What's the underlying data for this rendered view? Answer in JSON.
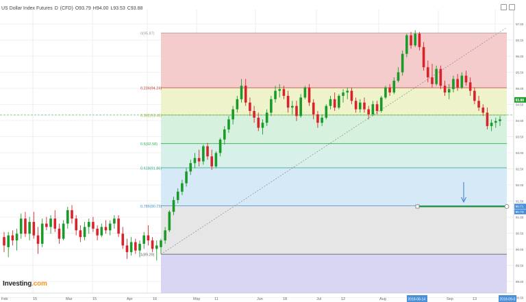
{
  "header": {
    "symbol": "US Dollar Index Futures",
    "interval": "D",
    "source": "(CFD)",
    "open": "O93.79",
    "high": "H94.00",
    "low": "L93.53",
    "close": "C93.88"
  },
  "logo": {
    "brand": "Investing",
    "suffix": ".com"
  },
  "colors": {
    "up": "#1a9a29",
    "down": "#d8232a",
    "accent": "#1f8e2c",
    "marker": "#3b79c9",
    "axis_tag": "#4a90d9"
  },
  "chart_data": {
    "type": "candlestick",
    "title": "US Dollar Index Futures, D, (CFD)",
    "xlabel": "",
    "ylabel": "",
    "ylim": [
      88.2,
      97.3
    ],
    "x_ticks": [
      "Feb",
      "15",
      "Mar",
      "15",
      "Apr",
      "16",
      "May",
      "11",
      "Jun",
      "18",
      "Jul",
      "12",
      "Aug",
      "13",
      "Sep",
      "13"
    ],
    "y_ticks": [
      "97.00",
      "96.50",
      "96.00",
      "95.50",
      "95.00",
      "94.50",
      "94.00",
      "93.50",
      "93.00",
      "92.50",
      "92.00",
      "91.50",
      "91.00",
      "90.50",
      "90.00",
      "89.50",
      "89.00",
      "88.50"
    ],
    "current_price": "93.88",
    "date_tags": [
      "2018-08-14",
      "2018-09-0"
    ],
    "fibonacci": {
      "from": 89.29,
      "to": 95.87,
      "levels": [
        {
          "ratio": 0,
          "label": "0(95.87)",
          "price": 95.87
        },
        {
          "ratio": 0.236,
          "label": "0.236(94.24)",
          "price": 94.24
        },
        {
          "ratio": 0.382,
          "label": "0.382(93.43)",
          "price": 93.43
        },
        {
          "ratio": 0.5,
          "label": "0.5(92.58)",
          "price": 92.58
        },
        {
          "ratio": 0.618,
          "label": "0.618(91.86)",
          "price": 91.86
        },
        {
          "ratio": 0.786,
          "label": "0.786(90.73)",
          "price": 90.73
        },
        {
          "ratio": 1,
          "label": "1(89.29)",
          "price": 89.29
        }
      ],
      "zone_colors": [
        "#f4cccc",
        "#eef3cc",
        "#d6f1dd",
        "#d7f1ea",
        "#d6e9f6",
        "#e6e6e6",
        "#d9d6f4"
      ]
    },
    "price_line": {
      "price": 90.71,
      "tags": [
        "90.71",
        "90.73"
      ]
    },
    "candles": [
      {
        "o": 89.8,
        "h": 89.95,
        "l": 89.35,
        "c": 89.55
      },
      {
        "o": 89.5,
        "h": 89.95,
        "l": 89.2,
        "c": 89.85
      },
      {
        "o": 89.85,
        "h": 90.0,
        "l": 89.55,
        "c": 89.7
      },
      {
        "o": 89.7,
        "h": 90.05,
        "l": 89.4,
        "c": 89.9
      },
      {
        "o": 89.9,
        "h": 90.5,
        "l": 89.75,
        "c": 90.35
      },
      {
        "o": 90.35,
        "h": 90.55,
        "l": 89.8,
        "c": 89.9
      },
      {
        "o": 89.9,
        "h": 90.4,
        "l": 89.7,
        "c": 90.25
      },
      {
        "o": 90.25,
        "h": 90.55,
        "l": 89.75,
        "c": 89.85
      },
      {
        "o": 89.85,
        "h": 90.1,
        "l": 89.3,
        "c": 89.6
      },
      {
        "o": 89.6,
        "h": 90.35,
        "l": 89.5,
        "c": 90.2
      },
      {
        "o": 90.2,
        "h": 90.4,
        "l": 90.0,
        "c": 90.1
      },
      {
        "o": 90.1,
        "h": 90.45,
        "l": 89.9,
        "c": 90.35
      },
      {
        "o": 90.35,
        "h": 90.6,
        "l": 89.95,
        "c": 90.05
      },
      {
        "o": 90.05,
        "h": 90.2,
        "l": 89.6,
        "c": 89.75
      },
      {
        "o": 89.75,
        "h": 90.3,
        "l": 89.7,
        "c": 90.2
      },
      {
        "o": 90.2,
        "h": 90.7,
        "l": 90.05,
        "c": 90.6
      },
      {
        "o": 90.6,
        "h": 90.75,
        "l": 90.2,
        "c": 90.35
      },
      {
        "o": 90.35,
        "h": 90.45,
        "l": 89.85,
        "c": 90.0
      },
      {
        "o": 90.0,
        "h": 90.15,
        "l": 89.65,
        "c": 89.8
      },
      {
        "o": 89.8,
        "h": 90.25,
        "l": 89.7,
        "c": 90.1
      },
      {
        "o": 90.1,
        "h": 90.35,
        "l": 89.9,
        "c": 90.25
      },
      {
        "o": 90.25,
        "h": 90.4,
        "l": 89.95,
        "c": 90.05
      },
      {
        "o": 90.05,
        "h": 90.15,
        "l": 89.7,
        "c": 89.85
      },
      {
        "o": 89.85,
        "h": 90.2,
        "l": 89.8,
        "c": 90.1
      },
      {
        "o": 90.1,
        "h": 90.3,
        "l": 89.9,
        "c": 90.0
      },
      {
        "o": 90.0,
        "h": 90.3,
        "l": 89.85,
        "c": 90.2
      },
      {
        "o": 90.2,
        "h": 90.45,
        "l": 90.05,
        "c": 90.35
      },
      {
        "o": 90.35,
        "h": 90.45,
        "l": 89.8,
        "c": 89.9
      },
      {
        "o": 89.9,
        "h": 90.1,
        "l": 89.45,
        "c": 89.55
      },
      {
        "o": 89.55,
        "h": 89.75,
        "l": 89.15,
        "c": 89.35
      },
      {
        "o": 89.35,
        "h": 89.8,
        "l": 89.25,
        "c": 89.65
      },
      {
        "o": 89.65,
        "h": 89.75,
        "l": 89.3,
        "c": 89.4
      },
      {
        "o": 89.4,
        "h": 89.7,
        "l": 89.2,
        "c": 89.6
      },
      {
        "o": 89.6,
        "h": 89.95,
        "l": 89.45,
        "c": 89.85
      },
      {
        "o": 89.85,
        "h": 90.15,
        "l": 89.55,
        "c": 89.7
      },
      {
        "o": 89.7,
        "h": 89.8,
        "l": 89.35,
        "c": 89.45
      },
      {
        "o": 89.45,
        "h": 89.7,
        "l": 89.1,
        "c": 89.55
      },
      {
        "o": 89.5,
        "h": 89.75,
        "l": 89.3,
        "c": 89.7
      },
      {
        "o": 89.7,
        "h": 90.1,
        "l": 89.6,
        "c": 90.0
      },
      {
        "o": 90.0,
        "h": 90.6,
        "l": 89.95,
        "c": 90.55
      },
      {
        "o": 90.55,
        "h": 91.0,
        "l": 90.45,
        "c": 90.9
      },
      {
        "o": 90.9,
        "h": 91.25,
        "l": 90.8,
        "c": 91.15
      },
      {
        "o": 91.15,
        "h": 91.5,
        "l": 91.05,
        "c": 91.4
      },
      {
        "o": 91.4,
        "h": 91.85,
        "l": 91.3,
        "c": 91.75
      },
      {
        "o": 91.75,
        "h": 92.1,
        "l": 91.65,
        "c": 92.0
      },
      {
        "o": 92.0,
        "h": 92.3,
        "l": 91.85,
        "c": 92.15
      },
      {
        "o": 92.15,
        "h": 92.4,
        "l": 91.9,
        "c": 92.05
      },
      {
        "o": 92.05,
        "h": 92.55,
        "l": 91.95,
        "c": 92.5
      },
      {
        "o": 92.5,
        "h": 92.6,
        "l": 92.1,
        "c": 92.2
      },
      {
        "o": 92.2,
        "h": 92.4,
        "l": 91.8,
        "c": 91.9
      },
      {
        "o": 91.9,
        "h": 92.35,
        "l": 91.85,
        "c": 92.3
      },
      {
        "o": 92.3,
        "h": 92.75,
        "l": 92.2,
        "c": 92.7
      },
      {
        "o": 92.7,
        "h": 93.1,
        "l": 92.55,
        "c": 93.0
      },
      {
        "o": 93.0,
        "h": 93.4,
        "l": 92.9,
        "c": 93.3
      },
      {
        "o": 93.3,
        "h": 93.7,
        "l": 93.15,
        "c": 93.6
      },
      {
        "o": 93.6,
        "h": 94.0,
        "l": 93.5,
        "c": 93.9
      },
      {
        "o": 93.9,
        "h": 94.5,
        "l": 93.8,
        "c": 94.3
      },
      {
        "o": 94.3,
        "h": 94.5,
        "l": 93.7,
        "c": 93.8
      },
      {
        "o": 93.8,
        "h": 93.95,
        "l": 93.4,
        "c": 93.55
      },
      {
        "o": 93.55,
        "h": 93.7,
        "l": 93.2,
        "c": 93.35
      },
      {
        "o": 93.35,
        "h": 93.5,
        "l": 92.95,
        "c": 93.05
      },
      {
        "o": 93.05,
        "h": 93.3,
        "l": 92.85,
        "c": 93.2
      },
      {
        "o": 93.2,
        "h": 93.6,
        "l": 93.1,
        "c": 93.5
      },
      {
        "o": 93.5,
        "h": 94.0,
        "l": 93.4,
        "c": 93.9
      },
      {
        "o": 93.9,
        "h": 94.3,
        "l": 93.8,
        "c": 94.15
      },
      {
        "o": 94.15,
        "h": 94.35,
        "l": 93.95,
        "c": 94.2
      },
      {
        "o": 94.2,
        "h": 94.3,
        "l": 93.9,
        "c": 94.0
      },
      {
        "o": 94.0,
        "h": 94.15,
        "l": 93.5,
        "c": 93.65
      },
      {
        "o": 93.65,
        "h": 93.85,
        "l": 93.45,
        "c": 93.7
      },
      {
        "o": 93.7,
        "h": 93.85,
        "l": 93.25,
        "c": 93.4
      },
      {
        "o": 93.4,
        "h": 94.05,
        "l": 93.35,
        "c": 93.95
      },
      {
        "o": 93.95,
        "h": 94.3,
        "l": 93.9,
        "c": 94.25
      },
      {
        "o": 94.25,
        "h": 94.35,
        "l": 93.7,
        "c": 93.8
      },
      {
        "o": 93.8,
        "h": 93.9,
        "l": 93.3,
        "c": 93.45
      },
      {
        "o": 93.45,
        "h": 93.55,
        "l": 93.05,
        "c": 93.2
      },
      {
        "o": 93.2,
        "h": 93.45,
        "l": 93.1,
        "c": 93.35
      },
      {
        "o": 93.35,
        "h": 93.75,
        "l": 93.3,
        "c": 93.7
      },
      {
        "o": 93.7,
        "h": 94.0,
        "l": 93.6,
        "c": 93.9
      },
      {
        "o": 93.9,
        "h": 94.1,
        "l": 93.55,
        "c": 93.65
      },
      {
        "o": 93.65,
        "h": 94.05,
        "l": 93.6,
        "c": 94.0
      },
      {
        "o": 94.0,
        "h": 94.2,
        "l": 93.8,
        "c": 94.1
      },
      {
        "o": 94.1,
        "h": 94.25,
        "l": 93.9,
        "c": 94.15
      },
      {
        "o": 94.15,
        "h": 94.25,
        "l": 93.75,
        "c": 93.85
      },
      {
        "o": 93.85,
        "h": 93.95,
        "l": 93.5,
        "c": 93.6
      },
      {
        "o": 93.6,
        "h": 93.9,
        "l": 93.5,
        "c": 93.8
      },
      {
        "o": 93.8,
        "h": 93.95,
        "l": 93.5,
        "c": 93.6
      },
      {
        "o": 93.6,
        "h": 93.7,
        "l": 93.3,
        "c": 93.45
      },
      {
        "o": 93.45,
        "h": 93.85,
        "l": 93.4,
        "c": 93.75
      },
      {
        "o": 93.75,
        "h": 93.85,
        "l": 93.45,
        "c": 93.55
      },
      {
        "o": 93.55,
        "h": 94.0,
        "l": 93.5,
        "c": 93.95
      },
      {
        "o": 93.95,
        "h": 94.3,
        "l": 93.9,
        "c": 94.25
      },
      {
        "o": 94.25,
        "h": 94.35,
        "l": 94.0,
        "c": 94.1
      },
      {
        "o": 94.1,
        "h": 94.55,
        "l": 94.05,
        "c": 94.45
      },
      {
        "o": 94.45,
        "h": 94.85,
        "l": 94.4,
        "c": 94.7
      },
      {
        "o": 94.7,
        "h": 95.35,
        "l": 94.6,
        "c": 95.25
      },
      {
        "o": 95.25,
        "h": 95.85,
        "l": 95.15,
        "c": 95.8
      },
      {
        "o": 95.8,
        "h": 95.9,
        "l": 95.4,
        "c": 95.5
      },
      {
        "o": 95.5,
        "h": 95.95,
        "l": 95.45,
        "c": 95.85
      },
      {
        "o": 95.85,
        "h": 95.9,
        "l": 95.35,
        "c": 95.45
      },
      {
        "o": 95.45,
        "h": 95.6,
        "l": 94.75,
        "c": 94.85
      },
      {
        "o": 94.85,
        "h": 95.05,
        "l": 94.4,
        "c": 94.55
      },
      {
        "o": 94.55,
        "h": 94.95,
        "l": 94.25,
        "c": 94.35
      },
      {
        "o": 94.35,
        "h": 94.9,
        "l": 94.3,
        "c": 94.8
      },
      {
        "o": 94.8,
        "h": 94.9,
        "l": 94.2,
        "c": 94.3
      },
      {
        "o": 94.3,
        "h": 94.45,
        "l": 94.0,
        "c": 94.1
      },
      {
        "o": 94.1,
        "h": 94.35,
        "l": 93.9,
        "c": 94.2
      },
      {
        "o": 94.2,
        "h": 94.6,
        "l": 94.1,
        "c": 94.5
      },
      {
        "o": 94.5,
        "h": 94.65,
        "l": 94.15,
        "c": 94.25
      },
      {
        "o": 94.25,
        "h": 94.7,
        "l": 94.2,
        "c": 94.6
      },
      {
        "o": 94.6,
        "h": 94.75,
        "l": 94.3,
        "c": 94.4
      },
      {
        "o": 94.4,
        "h": 94.55,
        "l": 94.0,
        "c": 94.15
      },
      {
        "o": 94.15,
        "h": 94.25,
        "l": 93.75,
        "c": 93.85
      },
      {
        "o": 93.85,
        "h": 94.0,
        "l": 93.55,
        "c": 93.65
      },
      {
        "o": 93.65,
        "h": 93.75,
        "l": 93.4,
        "c": 93.5
      },
      {
        "o": 93.5,
        "h": 93.65,
        "l": 93.0,
        "c": 93.1
      },
      {
        "o": 93.1,
        "h": 93.3,
        "l": 92.95,
        "c": 93.2
      },
      {
        "o": 93.2,
        "h": 93.35,
        "l": 93.05,
        "c": 93.25
      },
      {
        "o": 93.25,
        "h": 93.4,
        "l": 93.1,
        "c": 93.3
      }
    ]
  }
}
